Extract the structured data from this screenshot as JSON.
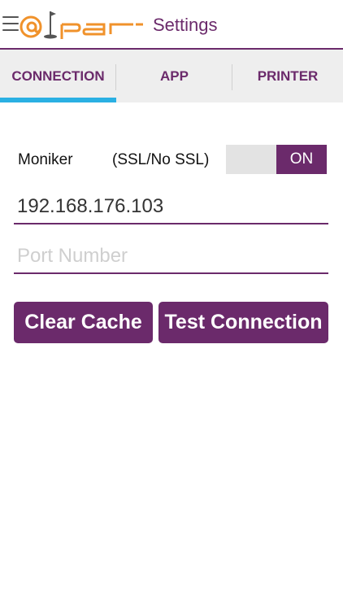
{
  "header": {
    "title": "Settings",
    "logo_text": "@par",
    "menu_icon": "hamburger-menu-icon"
  },
  "tabs": [
    {
      "label": "CONNECTION",
      "active": true
    },
    {
      "label": "APP",
      "active": false
    },
    {
      "label": "PRINTER",
      "active": false
    }
  ],
  "connection": {
    "moniker_label": "Moniker",
    "ssl_label": "(SSL/No SSL)",
    "ssl_toggle": {
      "state_label": "ON",
      "on": true
    },
    "ip_field": {
      "value": "192.168.176.103",
      "placeholder": ""
    },
    "port_field": {
      "value": "",
      "placeholder": "Port Number"
    },
    "clear_cache_label": "Clear Cache",
    "test_connection_label": "Test Connection"
  },
  "colors": {
    "brand_purple": "#6b2a6b",
    "logo_orange": "#f0922b",
    "active_tab_indicator": "#2ab0e3",
    "tabbar_bg": "#eeeeee",
    "toggle_track": "#e3e3e3"
  }
}
